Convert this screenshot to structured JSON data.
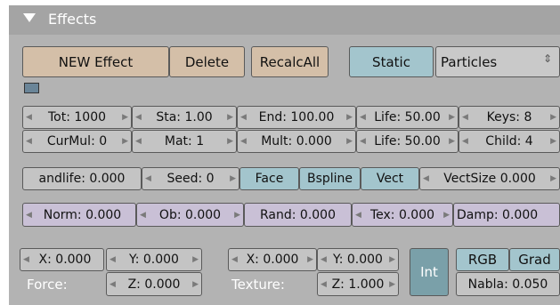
{
  "header": {
    "title": "Effects"
  },
  "toolbar": {
    "new_effect": "NEW Effect",
    "delete": "Delete",
    "recalc_all": "RecalcAll",
    "static": "Static",
    "type_select": "Particles"
  },
  "row1": {
    "tot": "Tot: 1000",
    "sta": "Sta: 1.00",
    "end": "End: 100.00",
    "life": "Life: 50.00",
    "keys": "Keys: 8"
  },
  "row2": {
    "curmul": "CurMul: 0",
    "mat": "Mat: 1",
    "mult": "Mult: 0.000",
    "life": "Life: 50.00",
    "child": "Child: 4"
  },
  "row3": {
    "randlife": "andlife: 0.000",
    "seed": "Seed: 0",
    "face": "Face",
    "bspline": "Bspline",
    "vect": "Vect",
    "vectsize": "VectSize 0.000"
  },
  "row4": {
    "norm": "Norm: 0.000",
    "ob": "Ob: 0.000",
    "rand": "Rand: 0.000",
    "tex": "Tex: 0.000",
    "damp": "Damp: 0.000"
  },
  "force": {
    "x": "X: 0.000",
    "y": "Y: 0.000",
    "z": "Z: 0.000",
    "label": "Force:"
  },
  "texture": {
    "x": "X: 0.000",
    "y": "Y: 0.000",
    "z": "Z: 1.000",
    "label": "Texture:"
  },
  "extra": {
    "int": "Int",
    "rgb": "RGB",
    "grad": "Grad",
    "nabla": "Nabla: 0.050"
  },
  "icons": {
    "collapse": "collapse-triangle-icon",
    "select": "updown-arrow-icon"
  }
}
